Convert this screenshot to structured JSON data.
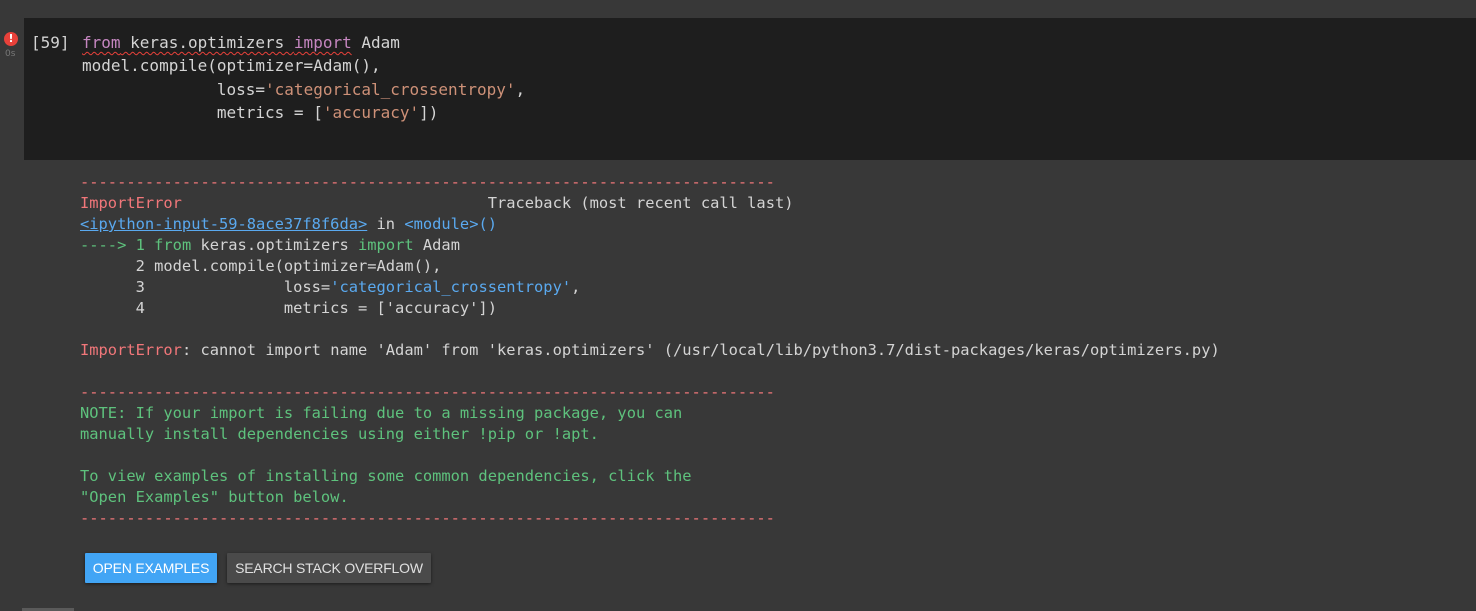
{
  "cell": {
    "status_icon": "error-icon",
    "execution_time": "0s",
    "execution_count": "[59]",
    "code": {
      "line1": {
        "kw1": "from",
        "module": " keras.optimizers ",
        "kw2": "import",
        "name": " Adam"
      },
      "line2": "model.compile(optimizer=Adam(),",
      "line3": {
        "indent": "              loss=",
        "string": "'categorical_crossentropy'",
        "tail": ","
      },
      "line4": {
        "indent": "              metrics = [",
        "string": "'accuracy'",
        "tail": "])"
      }
    }
  },
  "output": {
    "separator": "---------------------------------------------------------------------------",
    "error_name": "ImportError",
    "traceback_label": "                                 Traceback (most recent call last)",
    "input_link": "<ipython-input-59-8ace37f8f6da>",
    "in_text": " in ",
    "module": "<module>()",
    "tb_line1": {
      "arrow": "----> 1 ",
      "kw1": "from",
      "module": " keras.optimizers ",
      "kw2": "import",
      "name": " Adam"
    },
    "tb_line2": "      2 model.compile(optimizer=Adam(),",
    "tb_line3": {
      "indent": "      3               loss=",
      "string": "'categorical_crossentropy'",
      "tail": ","
    },
    "tb_line4": "      4               metrics = ['accuracy'])",
    "error_message": ": cannot import name 'Adam' from 'keras.optimizers' (/usr/local/lib/python3.7/dist-packages/keras/optimizers.py)",
    "note_line1": "NOTE: If your import is failing due to a missing package, you can",
    "note_line2": "manually install dependencies using either !pip or !apt.",
    "note_line3": "To view examples of installing some common dependencies, click the",
    "note_line4": "\"Open Examples\" button below."
  },
  "buttons": {
    "open_examples": "OPEN EXAMPLES",
    "search_stack_overflow": "SEARCH STACK OVERFLOW"
  },
  "colors": {
    "error_red": "#f2777a",
    "note_green": "#5ec27d",
    "link_blue": "#5aa9ef",
    "primary_button": "#42a5f5"
  }
}
